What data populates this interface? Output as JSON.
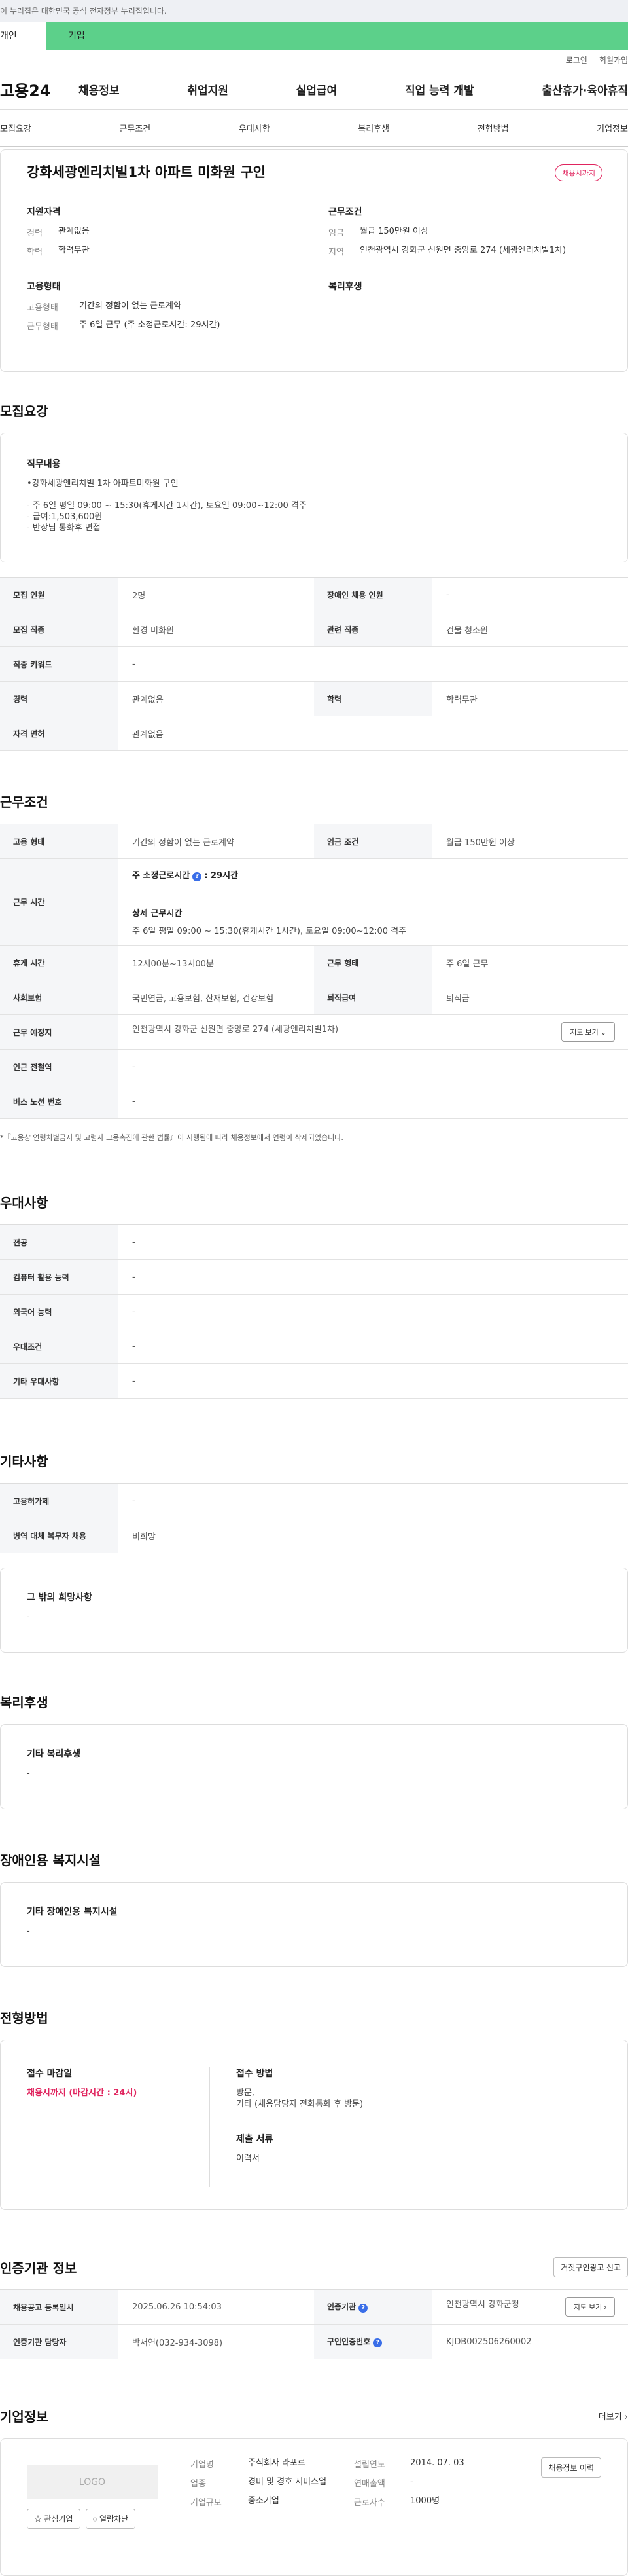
{
  "gov_banner": "이 누리집은 대한민국 공식 전자정부 누리집입니다.",
  "tabs": {
    "personal": "개인",
    "business": "기업"
  },
  "util": {
    "login": "로그인",
    "join": "회원가입"
  },
  "gnb": {
    "logo": "고용24",
    "menu": [
      "채용정보",
      "취업지원",
      "실업급여",
      "직업 능력 개발",
      "출산휴가·육아휴직"
    ]
  },
  "snb": [
    "모집요강",
    "근무조건",
    "우대사항",
    "복리후생",
    "전형방법",
    "기업정보"
  ],
  "summary": {
    "title": "강화세광엔리치빌1차 아파트 미화원 구인",
    "badge": "채용시까지",
    "support_h": "지원자격",
    "work_h": "근무조건",
    "career_k": "경력",
    "career_v": "관계없음",
    "edu_k": "학력",
    "edu_v": "학력무관",
    "wage_k": "임금",
    "wage_v": "월급 150만원 이상",
    "region_k": "지역",
    "region_v": "인천광역시 강화군 선원면 중앙로 274 (세광엔리치빌1차)",
    "emptype_h": "고용형태",
    "welfare_h": "복리후생",
    "emptype_k": "고용형태",
    "emptype_v": "기간의 정함이 없는 근로계약",
    "worktype_k": "근무형태",
    "worktype_v": "주 6일 근무 (주 소정근로시간: 29시간)"
  },
  "recruit": {
    "title": "모집요강",
    "job_h": "직무내용",
    "job_lines": [
      "•강화세광엔리치빌 1차 아파트미화원 구인",
      "",
      "- 주 6일 평일 09:00 ~ 15:30(휴게시간 1시간),  토요일 09:00~12:00 격주",
      "- 급여:1,503,600원",
      "- 반장님 통화후 면접"
    ],
    "rows": [
      {
        "k1": "모집 인원",
        "v1": "2명",
        "k2": "장애인 채용 인원",
        "v2": "-"
      },
      {
        "k1": "모집 직종",
        "v1": "환경 미화원",
        "k2": "관련 직종",
        "v2": "건물 청소원"
      },
      {
        "k1": "직종 키워드",
        "v1": "-"
      },
      {
        "k1": "경력",
        "v1": "관계없음",
        "k2": "학력",
        "v2": "학력무관"
      },
      {
        "k1": "자격 면허",
        "v1": "관계없음"
      }
    ]
  },
  "work": {
    "title": "근무조건",
    "emptype_k": "고용 형태",
    "emptype_v": "기간의 정함이 없는 근로계약",
    "wage_k": "임금 조건",
    "wage_v": "월급 150만원 이상",
    "time_k": "근무 시간",
    "time_h1": "주 소정근로시간",
    "time_v1": ": 29시간",
    "time_h2": "상세 근무시간",
    "time_v2": "주 6일 평일 09:00 ~ 15:30(휴게시간 1시간), 토요일 09:00~12:00 격주",
    "rest_k": "휴게 시간",
    "rest_v": "12시00분~13시00분",
    "wtype_k": "근무 형태",
    "wtype_v": "주 6일 근무",
    "ins_k": "사회보험",
    "ins_v": "국민연금, 고용보험, 산재보험, 건강보험",
    "sev_k": "퇴직급여",
    "sev_v": "퇴직금",
    "addr_k": "근무 예정지",
    "addr_v": "인천광역시 강화군 선원면 중앙로 274 (세광엔리치빌1차)",
    "map_btn": "지도 보기 ⌄",
    "station_k": "인근 전철역",
    "station_v": "-",
    "bus_k": "버스 노선 번호",
    "bus_v": "-",
    "note": "*『고용상 연령차별금지 및 고령자 고용촉진에 관한 법률』이 시행됨에 따라 채용정보에서 연령이 삭제되었습니다."
  },
  "pref": {
    "title": "우대사항",
    "rows": [
      {
        "k": "전공",
        "v": "-"
      },
      {
        "k": "컴퓨터 활용 능력",
        "v": "-"
      },
      {
        "k": "외국어 능력",
        "v": "-"
      },
      {
        "k": "우대조건",
        "v": "-"
      },
      {
        "k": "기타 우대사항",
        "v": "-"
      }
    ]
  },
  "etc": {
    "title": "기타사항",
    "rows": [
      {
        "k": "고용허가제",
        "v": "-"
      },
      {
        "k": "병역 대체 복무자 채용",
        "v": "비희망"
      }
    ],
    "other_h": "그 밖의 희망사항",
    "other_v": "-"
  },
  "welfare": {
    "title": "복리후생",
    "h": "기타 복리후생",
    "v": "-"
  },
  "disab": {
    "title": "장애인용 복지시설",
    "h": "기타 장애인용 복지시설",
    "v": "-"
  },
  "select": {
    "title": "전형방법",
    "deadline_h": "접수 마감일",
    "deadline_v": "채용시까지 (마감시간 : 24시)",
    "method_h": "접수 방법",
    "method_v1": "방문,",
    "method_v2": "기타 (채용담당자 전화통화 후 방문)",
    "docs_h": "제출 서류",
    "docs_v": "이력서"
  },
  "cert": {
    "title": "인증기관 정보",
    "report_btn": "거짓구인광고 신고",
    "reg_k": "채용공고 등록일시",
    "reg_v": "2025.06.26 10:54:03",
    "org_k": "인증기관",
    "org_v": "인천광역시 강화군청",
    "map_btn": "지도 보기 ›",
    "mgr_k": "인증기관 담당자",
    "mgr_v": "박서연(032-934-3098)",
    "no_k": "구인인증번호",
    "no_v": "KJDB002506260002"
  },
  "company": {
    "title": "기업정보",
    "more": "더보기 ›",
    "logo": "LOGO",
    "fav_btn": "☆ 관심기업",
    "block_btn": "◌ 열람차단",
    "name_k": "기업명",
    "name_v": "주식회사 라포르",
    "ind_k": "업종",
    "ind_v": "경비 및 경호 서비스업",
    "size_k": "기업규모",
    "size_v": "중소기업",
    "year_k": "설립연도",
    "year_v": "2014. 07. 03",
    "sales_k": "연매출액",
    "sales_v": "-",
    "emp_k": "근로자수",
    "emp_v": "1000명",
    "hist_btn": "채용정보 이력"
  }
}
